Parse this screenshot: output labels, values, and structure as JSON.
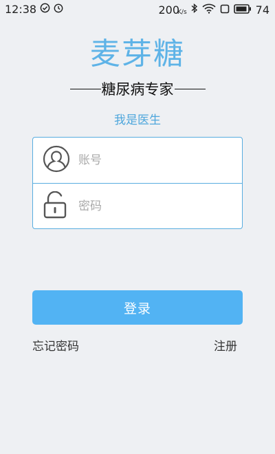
{
  "status_bar": {
    "time": "12:38",
    "speed_value": "200",
    "speed_unit": "K/s",
    "battery": "74"
  },
  "brand": {
    "title": "麦芽糖"
  },
  "tagline": {
    "text": "糖尿病专家"
  },
  "role": {
    "label": "我是医生"
  },
  "form": {
    "account_placeholder": "账号",
    "account_value": "",
    "password_placeholder": "密码",
    "password_value": ""
  },
  "actions": {
    "login_label": "登录",
    "forgot_label": "忘记密码",
    "register_label": "注册"
  },
  "colors": {
    "accent": "#5eb3e7",
    "button": "#52b3f3",
    "background": "#eef0f3"
  }
}
